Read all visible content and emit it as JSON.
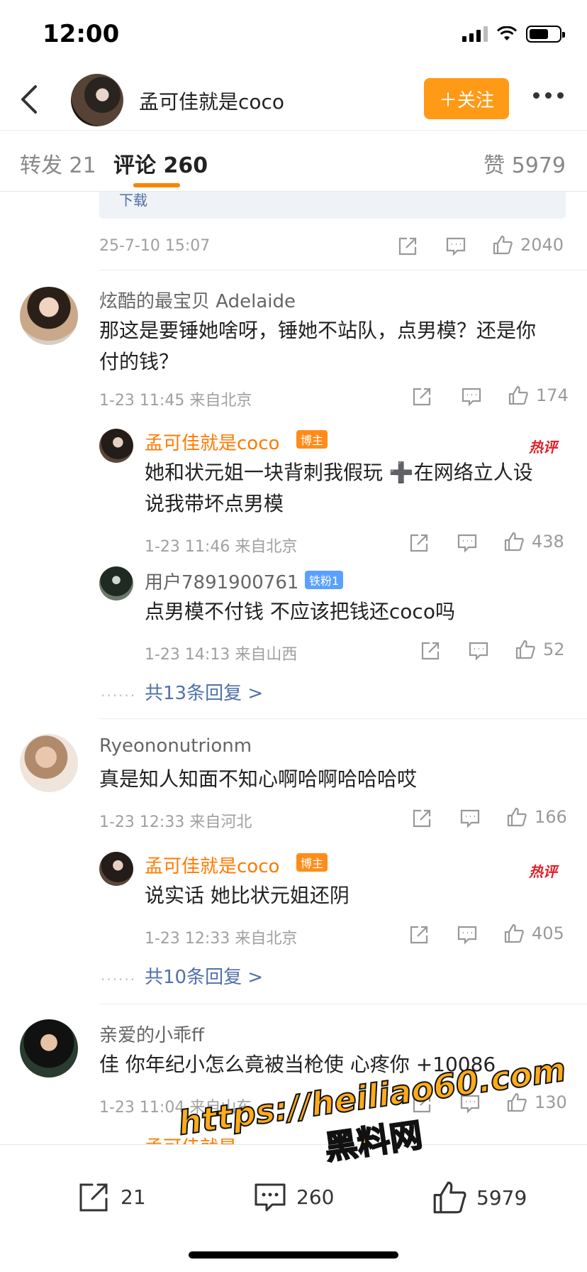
{
  "status_bar": {
    "time": "12:00"
  },
  "header": {
    "name": "孟可佳就是coco",
    "follow_label": "＋关注"
  },
  "tabs": {
    "repost": "转发 21",
    "comments": "评论 260",
    "likes": "赞 5979"
  },
  "partial_card": {
    "text": "下载"
  },
  "post_meta": {
    "time": "25-7-10 15:07",
    "likes": "2040"
  },
  "comments": [
    {
      "user": "炫酷的最宝贝 Adelaide",
      "text_line1": "那这是要锤她啥呀，锤她不站队，点男模？还是你",
      "text_line2": "付的钱？",
      "meta": "1-23 11:45  来自北京",
      "likes": "174",
      "replies": [
        {
          "user": "孟可佳就是coco",
          "badge": "博主",
          "hot": "热评",
          "text_line1": "她和状元姐一块背刺我假玩 ➕在网络立人设",
          "text_line2": "说我带坏点男模",
          "meta": "1-23 11:46  来自北京",
          "likes": "438"
        },
        {
          "user": "用户7891900761",
          "badge": "铁粉1",
          "text_line1": "点男模不付钱 不应该把钱还coco吗",
          "meta": "1-23 14:13  来自山西",
          "likes": "52"
        }
      ],
      "more_replies": "共13条回复 >"
    },
    {
      "user": "Ryeononutrionm",
      "text_line1": "真是知人知面不知心啊哈啊哈哈哈哎",
      "meta": "1-23 12:33  来自河北",
      "likes": "166",
      "replies": [
        {
          "user": "孟可佳就是coco",
          "badge": "博主",
          "hot": "热评",
          "text_line1": "说实话 她比状元姐还阴",
          "meta": "1-23 12:33  来自北京",
          "likes": "405"
        }
      ],
      "more_replies": "共10条回复 >"
    },
    {
      "user": "亲爱的小乖ff",
      "text_line1": "佳 你年纪小怎么竟被当枪使 心疼你 +10086",
      "meta": "1-23 11:04  来自山东",
      "likes": "130",
      "partial_reply_user": "孟可佳就是"
    }
  ],
  "bottom_bar": {
    "reposts": "21",
    "comments": "260",
    "likes": "5979"
  },
  "watermark": {
    "line1": "https://heiliao60.com",
    "line2": "黑料网"
  }
}
